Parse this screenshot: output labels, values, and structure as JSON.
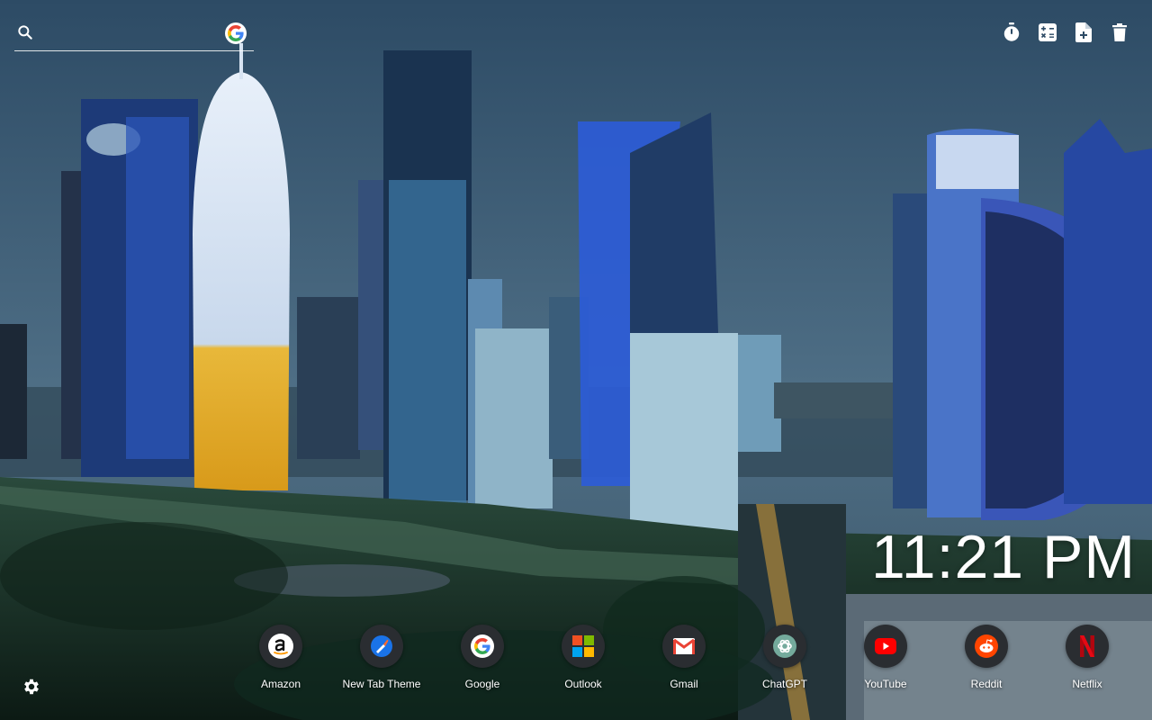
{
  "search": {
    "placeholder": ""
  },
  "toolbar": {
    "buttons": [
      {
        "name": "timer-icon"
      },
      {
        "name": "calculator-icon"
      },
      {
        "name": "new-note-icon"
      },
      {
        "name": "delete-icon"
      }
    ]
  },
  "clock": {
    "time": "11:21 PM"
  },
  "shortcuts": [
    {
      "label": "Amazon",
      "icon": "amazon-icon"
    },
    {
      "label": "New Tab Theme",
      "icon": "new-tab-theme-icon"
    },
    {
      "label": "Google",
      "icon": "google-icon"
    },
    {
      "label": "Outlook",
      "icon": "microsoft-icon"
    },
    {
      "label": "Gmail",
      "icon": "gmail-icon"
    },
    {
      "label": "ChatGPT",
      "icon": "chatgpt-icon"
    },
    {
      "label": "YouTube",
      "icon": "youtube-icon"
    },
    {
      "label": "Reddit",
      "icon": "reddit-icon"
    },
    {
      "label": "Netflix",
      "icon": "netflix-icon"
    }
  ],
  "colors": {
    "google_blue": "#4285F4",
    "google_red": "#EA4335",
    "google_yellow": "#FBBC05",
    "google_green": "#34A853",
    "amazon_orange": "#FF9900",
    "youtube_red": "#FF0000",
    "reddit_orange": "#FF4500",
    "netflix_red": "#E50914"
  }
}
